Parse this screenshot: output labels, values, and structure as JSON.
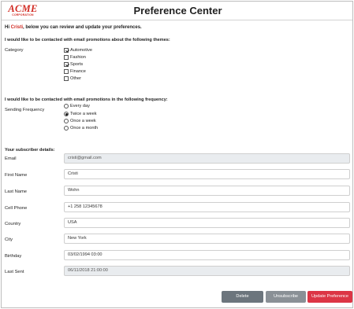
{
  "header": {
    "logo_main": "ACME",
    "logo_sub": "CORPORATION",
    "title": "Preference Center"
  },
  "greeting": {
    "prefix": "Hi ",
    "name": "Cristi",
    "suffix": ", below you can review and update your preferences."
  },
  "themes": {
    "heading": "I would like to be contacted with email promotions about the following themes:",
    "label": "Category",
    "options": [
      {
        "label": "Automotive",
        "checked": true
      },
      {
        "label": "Fashion",
        "checked": false
      },
      {
        "label": "Sports",
        "checked": true
      },
      {
        "label": "Finance",
        "checked": false
      },
      {
        "label": "Other",
        "checked": false
      }
    ]
  },
  "frequency": {
    "heading": "I would like to be contacted with email promotions in the following frequency:",
    "label": "Sending Frequency",
    "options": [
      {
        "label": "Every day",
        "checked": false
      },
      {
        "label": "Twice a week",
        "checked": true
      },
      {
        "label": "Once a week",
        "checked": false
      },
      {
        "label": "Once a month",
        "checked": false
      }
    ]
  },
  "subscriber": {
    "heading": "Your subscriber details:",
    "fields": [
      {
        "label": "Email",
        "value": "cristi@gmail.com",
        "disabled": true
      },
      {
        "label": "First Name",
        "value": "Cristi",
        "disabled": false
      },
      {
        "label": "Last Name",
        "value": "Wohn",
        "disabled": false
      },
      {
        "label": "Cell Phone",
        "value": "+1 258 12345678",
        "disabled": false
      },
      {
        "label": "Country",
        "value": "USA",
        "disabled": false
      },
      {
        "label": "City",
        "value": "New York",
        "disabled": false
      },
      {
        "label": "Birthday",
        "value": "03/02/1994 03:00",
        "disabled": false
      },
      {
        "label": "Last Sent",
        "value": "06/11/2018 21:00:00",
        "disabled": true
      }
    ]
  },
  "actions": {
    "delete": "Delete",
    "unsubscribe": "Unsubscribe",
    "update": "Update Preference"
  },
  "colors": {
    "brand_red": "#d12a22",
    "delete_button": "#6c757d",
    "unsubscribe_button": "#8a9096",
    "update_button": "#dc3545",
    "disabled_input": "#e9ecef"
  }
}
